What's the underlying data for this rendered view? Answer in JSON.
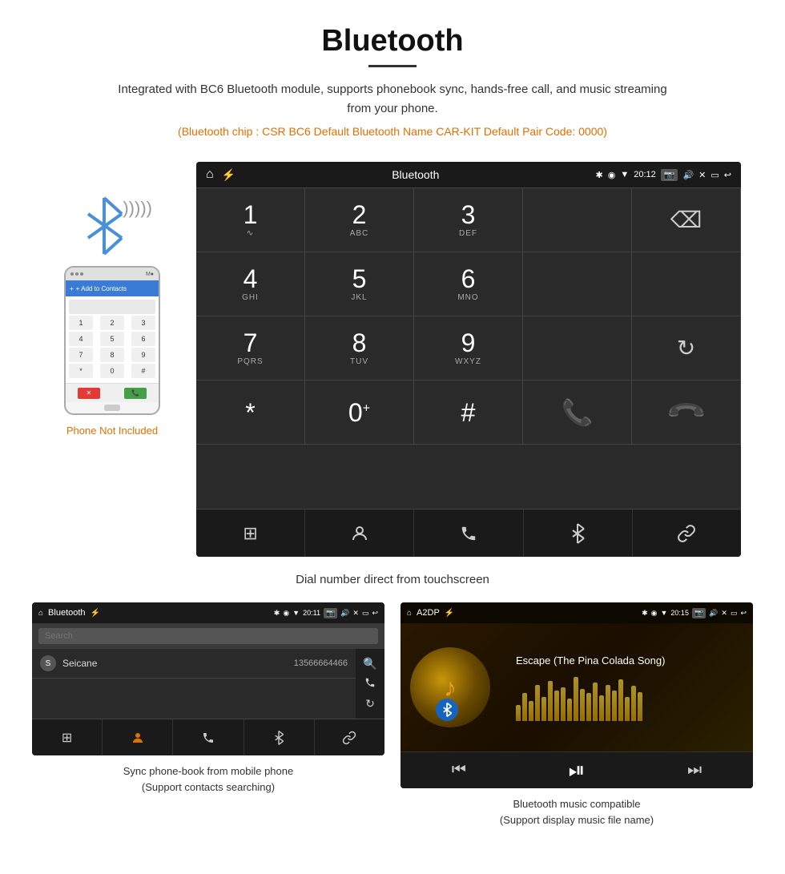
{
  "page": {
    "title": "Bluetooth",
    "description": "Integrated with BC6 Bluetooth module, supports phonebook sync, hands-free call, and music streaming from your phone.",
    "info_line": "(Bluetooth chip : CSR BC6    Default Bluetooth Name CAR-KIT    Default Pair Code: 0000)"
  },
  "main_screen": {
    "status_bar": {
      "home_icon": "⌂",
      "title": "Bluetooth",
      "usb_icon": "⚡",
      "bt_icon": "✱",
      "location_icon": "◉",
      "signal_icon": "▼",
      "time": "20:12",
      "camera_icon": "📷",
      "volume_icon": "🔊",
      "x_icon": "✕",
      "rect_icon": "▭",
      "back_icon": "↩"
    },
    "dial_keys": [
      {
        "num": "1",
        "sub": "∿",
        "row": 0,
        "col": 0
      },
      {
        "num": "2",
        "sub": "ABC",
        "row": 0,
        "col": 1
      },
      {
        "num": "3",
        "sub": "DEF",
        "row": 0,
        "col": 2
      },
      {
        "num": "",
        "sub": "",
        "row": 0,
        "col": 3,
        "type": "empty"
      },
      {
        "num": "⌫",
        "sub": "",
        "row": 0,
        "col": 4,
        "type": "backspace"
      },
      {
        "num": "4",
        "sub": "GHI",
        "row": 1,
        "col": 0
      },
      {
        "num": "5",
        "sub": "JKL",
        "row": 1,
        "col": 1
      },
      {
        "num": "6",
        "sub": "MNO",
        "row": 1,
        "col": 2
      },
      {
        "num": "",
        "sub": "",
        "row": 1,
        "col": 3,
        "type": "empty"
      },
      {
        "num": "",
        "sub": "",
        "row": 1,
        "col": 4,
        "type": "empty"
      },
      {
        "num": "7",
        "sub": "PQRS",
        "row": 2,
        "col": 0
      },
      {
        "num": "8",
        "sub": "TUV",
        "row": 2,
        "col": 1
      },
      {
        "num": "9",
        "sub": "WXYZ",
        "row": 2,
        "col": 2
      },
      {
        "num": "",
        "sub": "",
        "row": 2,
        "col": 3,
        "type": "empty"
      },
      {
        "num": "⟳",
        "sub": "",
        "row": 2,
        "col": 4,
        "type": "refresh"
      },
      {
        "num": "*",
        "sub": "",
        "row": 3,
        "col": 0
      },
      {
        "num": "0",
        "sub": "+",
        "row": 3,
        "col": 1
      },
      {
        "num": "#",
        "sub": "",
        "row": 3,
        "col": 2
      },
      {
        "num": "📞",
        "sub": "",
        "row": 3,
        "col": 3,
        "type": "call-green"
      },
      {
        "num": "📞",
        "sub": "",
        "row": 3,
        "col": 4,
        "type": "call-red"
      }
    ],
    "bottom_nav": [
      "⊞",
      "👤",
      "📞",
      "✱",
      "🔗"
    ]
  },
  "main_caption": "Dial number direct from touchscreen",
  "phone": {
    "not_included": "Phone Not Included",
    "add_contacts": "+ Add to Contacts",
    "keys": [
      [
        "1",
        "2",
        "3"
      ],
      [
        "4",
        "5",
        "6"
      ],
      [
        "7",
        "8",
        "9"
      ],
      [
        "*",
        "0",
        "#"
      ]
    ]
  },
  "phonebook_screen": {
    "status_bar": {
      "home": "⌂",
      "title": "Bluetooth",
      "usb": "⚡",
      "bt": "✱",
      "loc": "◉",
      "sig": "▼",
      "time": "20:11",
      "cam": "📷",
      "vol": "🔊",
      "x": "✕",
      "rect": "▭",
      "back": "↩"
    },
    "search_placeholder": "Search",
    "contact": {
      "letter": "S",
      "name": "Seicane",
      "number": "13566664466"
    },
    "right_icons": [
      "🔍",
      "📞",
      "⟳"
    ],
    "bottom_nav": [
      "⊞",
      "👤",
      "📞",
      "✱",
      "🔗"
    ]
  },
  "phonebook_caption": {
    "line1": "Sync phone-book from mobile phone",
    "line2": "(Support contacts searching)"
  },
  "music_screen": {
    "status_bar": {
      "home": "⌂",
      "title": "A2DP",
      "usb": "⚡",
      "bt": "✱",
      "loc": "◉",
      "sig": "▼",
      "time": "20:15",
      "cam": "📷",
      "vol": "🔊",
      "x": "✕",
      "rect": "▭",
      "back": "↩"
    },
    "song_title": "Escape (The Pina Colada Song)",
    "wave_heights": [
      20,
      35,
      25,
      45,
      30,
      50,
      38,
      42,
      28,
      55,
      40,
      35,
      48,
      32,
      45,
      38,
      52,
      30,
      44,
      36
    ],
    "controls": [
      "⏮",
      "⏯",
      "⏭"
    ]
  },
  "music_caption": {
    "line1": "Bluetooth music compatible",
    "line2": "(Support display music file name)"
  }
}
